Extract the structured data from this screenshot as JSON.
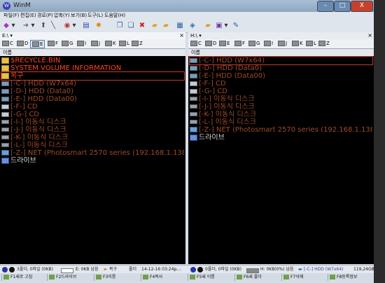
{
  "window": {
    "title": "WinM",
    "minimize": "–",
    "maximize": "□",
    "close": "X"
  },
  "menu": [
    "파일(F)",
    "편집(E)",
    "경로(P)",
    "압축(Y)",
    "보기(B)",
    "도구(L)",
    "도움말(H)"
  ],
  "toolbar_icons": [
    {
      "name": "back-icon",
      "glyph": "◆"
    },
    {
      "name": "back-dropdown-icon",
      "glyph": "▾"
    },
    {
      "name": "forward-icon",
      "glyph": "➜"
    },
    {
      "name": "forward-dropdown-icon",
      "glyph": "▾"
    },
    {
      "name": "up-icon",
      "glyph": "⬆"
    },
    {
      "name": "edit-icon",
      "glyph": "╲"
    },
    {
      "name": "refresh-icon",
      "glyph": "◉"
    },
    {
      "name": "refresh-dropdown-icon",
      "glyph": "▾"
    },
    {
      "name": "view-icon",
      "glyph": "▤"
    },
    {
      "name": "sun-icon",
      "glyph": "✹"
    },
    {
      "name": "copy-icon",
      "glyph": "❐"
    },
    {
      "name": "paste-icon",
      "glyph": "❏"
    },
    {
      "name": "delete-icon",
      "glyph": "✖"
    },
    {
      "name": "folder-icon",
      "glyph": "▰"
    },
    {
      "name": "folder-open-icon",
      "glyph": "▰"
    },
    {
      "name": "compress-icon",
      "glyph": "▦"
    },
    {
      "name": "sync-icon",
      "glyph": "◈"
    },
    {
      "name": "folder-star-icon",
      "glyph": "▰"
    },
    {
      "name": "window-icon",
      "glyph": "▣"
    },
    {
      "name": "window-dropdown-icon",
      "glyph": "▾"
    },
    {
      "name": "settings-icon",
      "glyph": "✎"
    }
  ],
  "left_pane": {
    "path": "E:\\ ▾",
    "close": "×",
    "drives": [
      "C",
      "D",
      "E",
      "F",
      "G",
      "I",
      "J",
      "K",
      "L",
      "Z"
    ],
    "selected_drive": "E",
    "column_header": "이름",
    "rows": [
      {
        "label": "$RECYCLE.BIN",
        "icon": "folder",
        "color": "#ff4422"
      },
      {
        "label": "SYSTEM VOLUME INFORMATION",
        "icon": "folder",
        "color": "#ff4422"
      },
      {
        "label": "복구",
        "icon": "folder",
        "color": "#ff4422",
        "selected": true
      },
      {
        "label": "[-C-] HDD (W7x64)",
        "icon": "hdd",
        "color": "#a04a28"
      },
      {
        "label": "[-D-] HDD (Data0)",
        "icon": "hdd",
        "color": "#a04a28"
      },
      {
        "label": "[-E-] HDD (Data00)",
        "icon": "hdd",
        "color": "#a04a28"
      },
      {
        "label": "[-F-] CD",
        "icon": "cd",
        "color": "#a04a28"
      },
      {
        "label": "[-G-] CD",
        "icon": "cd",
        "color": "#a04a28"
      },
      {
        "label": "[-I-] 이동식 디스크",
        "icon": "rem",
        "color": "#a04a28"
      },
      {
        "label": "[-J-] 이동식 디스크",
        "icon": "rem",
        "color": "#a04a28"
      },
      {
        "label": "[-K-] 이동식 디스크",
        "icon": "rem",
        "color": "#a04a28"
      },
      {
        "label": "[-L-] 이동식 디스크",
        "icon": "rem",
        "color": "#a04a28"
      },
      {
        "label": "[-Z-] NET (Photosmart 2570 series (192.168.1.138))",
        "icon": "net",
        "color": "#a04a28"
      },
      {
        "label": "드라이브",
        "icon": "drv",
        "color": "#d8d8d8"
      }
    ]
  },
  "right_pane": {
    "path": "H:\\ ▾",
    "close": "×",
    "drives": [
      "C",
      "D",
      "E",
      "F",
      "G",
      "I",
      "J",
      "K",
      "L",
      "Z"
    ],
    "column_header": "이름",
    "rows": [
      {
        "label": "[-C-] HDD (W7x64)",
        "icon": "hdd",
        "color": "#a04a28",
        "selected": true
      },
      {
        "label": "[-D-] HDD (Data0)",
        "icon": "hdd",
        "color": "#a04a28"
      },
      {
        "label": "[-E-] HDD (Data00)",
        "icon": "hdd",
        "color": "#a04a28"
      },
      {
        "label": "[-F-] CD",
        "icon": "cd",
        "color": "#a04a28"
      },
      {
        "label": "[-G-] CD",
        "icon": "cd",
        "color": "#a04a28"
      },
      {
        "label": "[-I-] 이동식 디스크",
        "icon": "rem",
        "color": "#a04a28"
      },
      {
        "label": "[-J-] 이동식 디스크",
        "icon": "rem",
        "color": "#a04a28"
      },
      {
        "label": "[-K-] 이동식 디스크",
        "icon": "rem",
        "color": "#a04a28"
      },
      {
        "label": "[-L-] 이동식 디스크",
        "icon": "rem",
        "color": "#a04a28"
      },
      {
        "label": "[-Z-] NET (Photosmart 2570 series (192.168.1.138))",
        "icon": "net",
        "color": "#a04a28"
      },
      {
        "label": "드라이브",
        "icon": "drv",
        "color": "#d8d8d8"
      }
    ]
  },
  "status": {
    "left_count": "3폴더, 0파일 (0KB)",
    "left_space": "E: 0KB 남음",
    "left_selected": "복구",
    "left_type": "폴더",
    "left_date": "14-12-16 03:24p",
    "left_extra": "......",
    "right_count": "0폴더, 0파일 (0KB)",
    "right_space": "H: 0KB(0%) 남음",
    "right_drive": "[-C-] HDD (W7x64)",
    "right_size": "119,24GB"
  },
  "fkeys": [
    "F1새로 고침",
    "F2드라이브",
    "F3이름",
    "F4복사",
    "F5새 이름",
    "F6새 폴더",
    "F7삭제",
    "F8등록정보"
  ]
}
